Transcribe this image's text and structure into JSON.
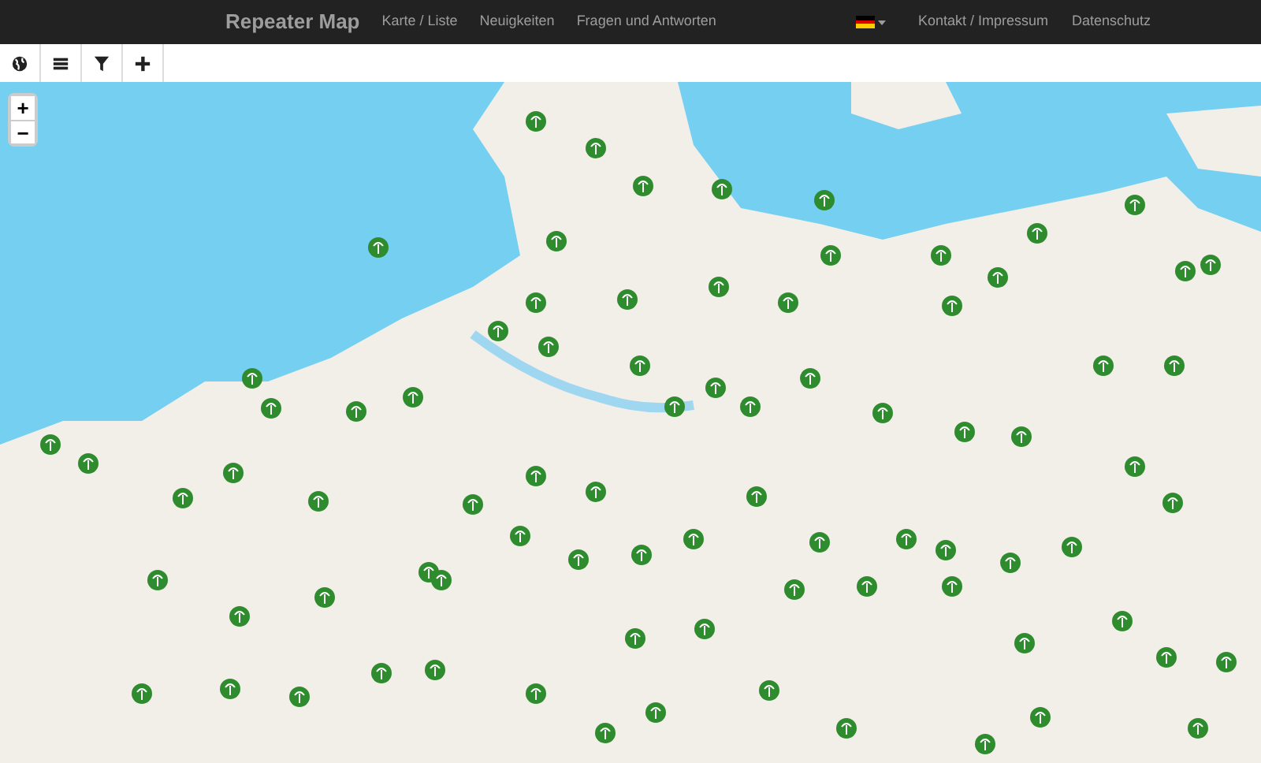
{
  "navbar": {
    "brand": "Repeater Map",
    "links": [
      {
        "label": "Karte / Liste"
      },
      {
        "label": "Neuigkeiten"
      },
      {
        "label": "Fragen und Antworten"
      }
    ],
    "right_links": [
      {
        "label": "Kontakt / Impressum"
      },
      {
        "label": "Datenschutz"
      }
    ]
  },
  "toolbar": {
    "buttons": [
      {
        "kind": "globe"
      },
      {
        "kind": "list"
      },
      {
        "kind": "filter"
      },
      {
        "kind": "add"
      }
    ]
  },
  "map": {
    "zoom_controls": [
      {
        "label": "+"
      },
      {
        "label": "−"
      }
    ]
  }
}
